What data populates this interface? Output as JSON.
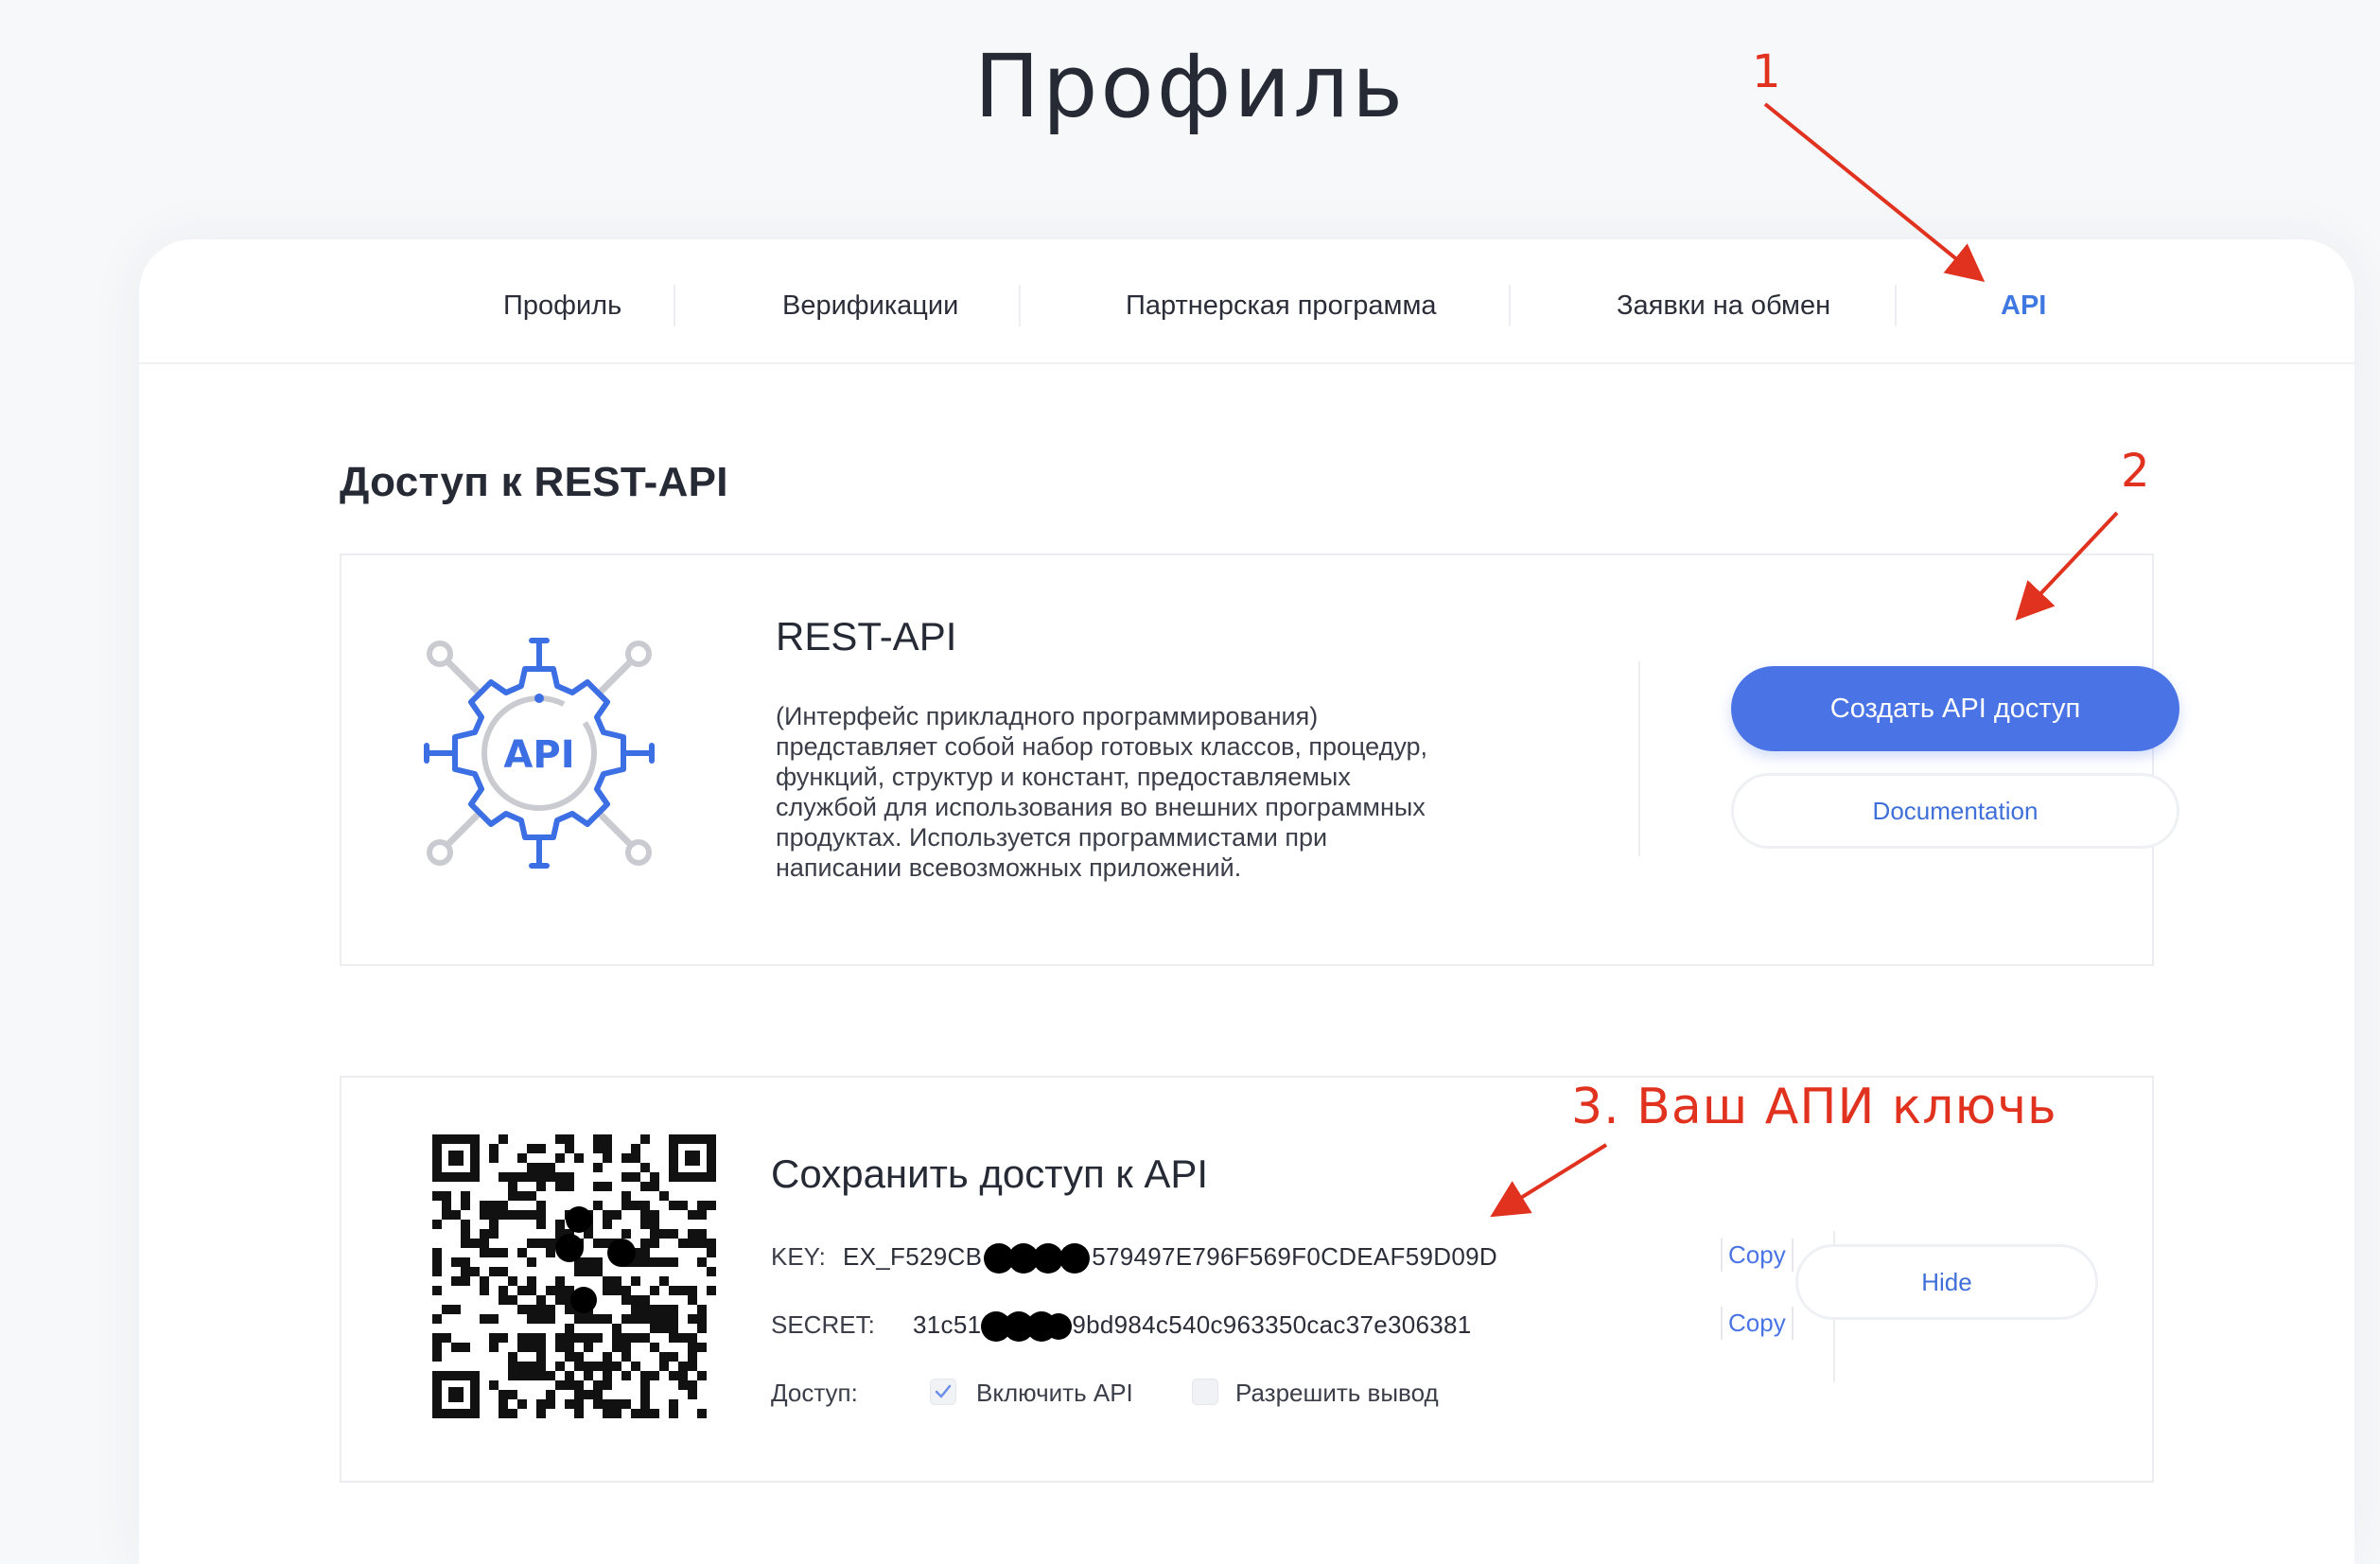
{
  "page": {
    "title": "Профиль"
  },
  "tabs": [
    {
      "label": "Профиль"
    },
    {
      "label": "Верификации"
    },
    {
      "label": "Партнерская программа"
    },
    {
      "label": "Заявки на обмен"
    },
    {
      "label": "API",
      "active": true
    }
  ],
  "section": {
    "title": "Доступ к REST-API"
  },
  "rest_card": {
    "logo_icon": "api-gear-icon",
    "logo_text": "API",
    "title": "REST-API",
    "description": "(Интерфейс прикладного программирования) представляет собой набор готовых классов, процедур, функций, структур и констант, предоставляемых службой для использования во внешних программных продуктах. Используется программистами при написании всевозможных приложений.",
    "create_button": "Создать API доступ",
    "doc_button": "Documentation"
  },
  "access_card": {
    "qr_icon": "qr-code-icon",
    "title": "Сохранить доступ к API",
    "key_label": "KEY:",
    "key_prefix": "EX_F529CB",
    "key_suffix": "579497E796F569F0CDEAF59D09D",
    "secret_label": "SECRET:",
    "secret_prefix": "31c51",
    "secret_suffix": "9bd984c540c963350cac37e306381",
    "copy_label": "Copy",
    "access_label": "Доступ:",
    "enable_api": {
      "label": "Включить API",
      "checked": true
    },
    "allow_withdraw": {
      "label": "Разрешить вывод",
      "checked": false
    },
    "hide_button": "Hide"
  },
  "annotations": {
    "one": "1",
    "two": "2",
    "three": "3. Ваш АПИ ключь",
    "color": "#e0321f"
  },
  "colors": {
    "accent": "#4a74e6",
    "active_tab": "#3f78e0",
    "gear_blue": "#3c6fe3",
    "gear_gray": "#c9cbd0"
  }
}
